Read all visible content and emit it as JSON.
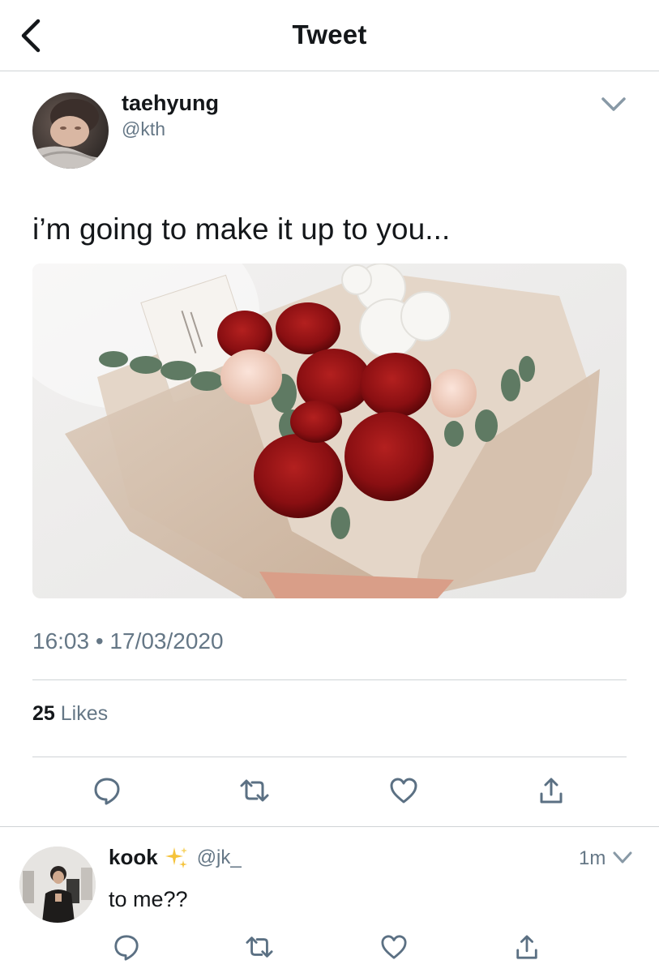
{
  "header": {
    "title": "Tweet"
  },
  "tweet": {
    "author_name": "taehyung",
    "author_handle": "@kth",
    "text": "i’m going to make it up to you...",
    "timestamp": "16:03 • 17/03/2020",
    "likes_count": "25",
    "likes_label": "Likes"
  },
  "reply": {
    "author_name": "kook",
    "author_handle": "@jk_",
    "time": "1m",
    "text": "to me??"
  },
  "icons": {
    "back": "chevron-left-icon",
    "caret": "chevron-down-icon",
    "reply": "comment-icon",
    "retweet": "retweet-icon",
    "like": "heart-icon",
    "share": "share-icon",
    "sparkle": "sparkles-emoji"
  },
  "colors": {
    "text": "#14171a",
    "secondary": "#657786",
    "divider": "#cfd3d6",
    "icon": "#5b7083"
  }
}
